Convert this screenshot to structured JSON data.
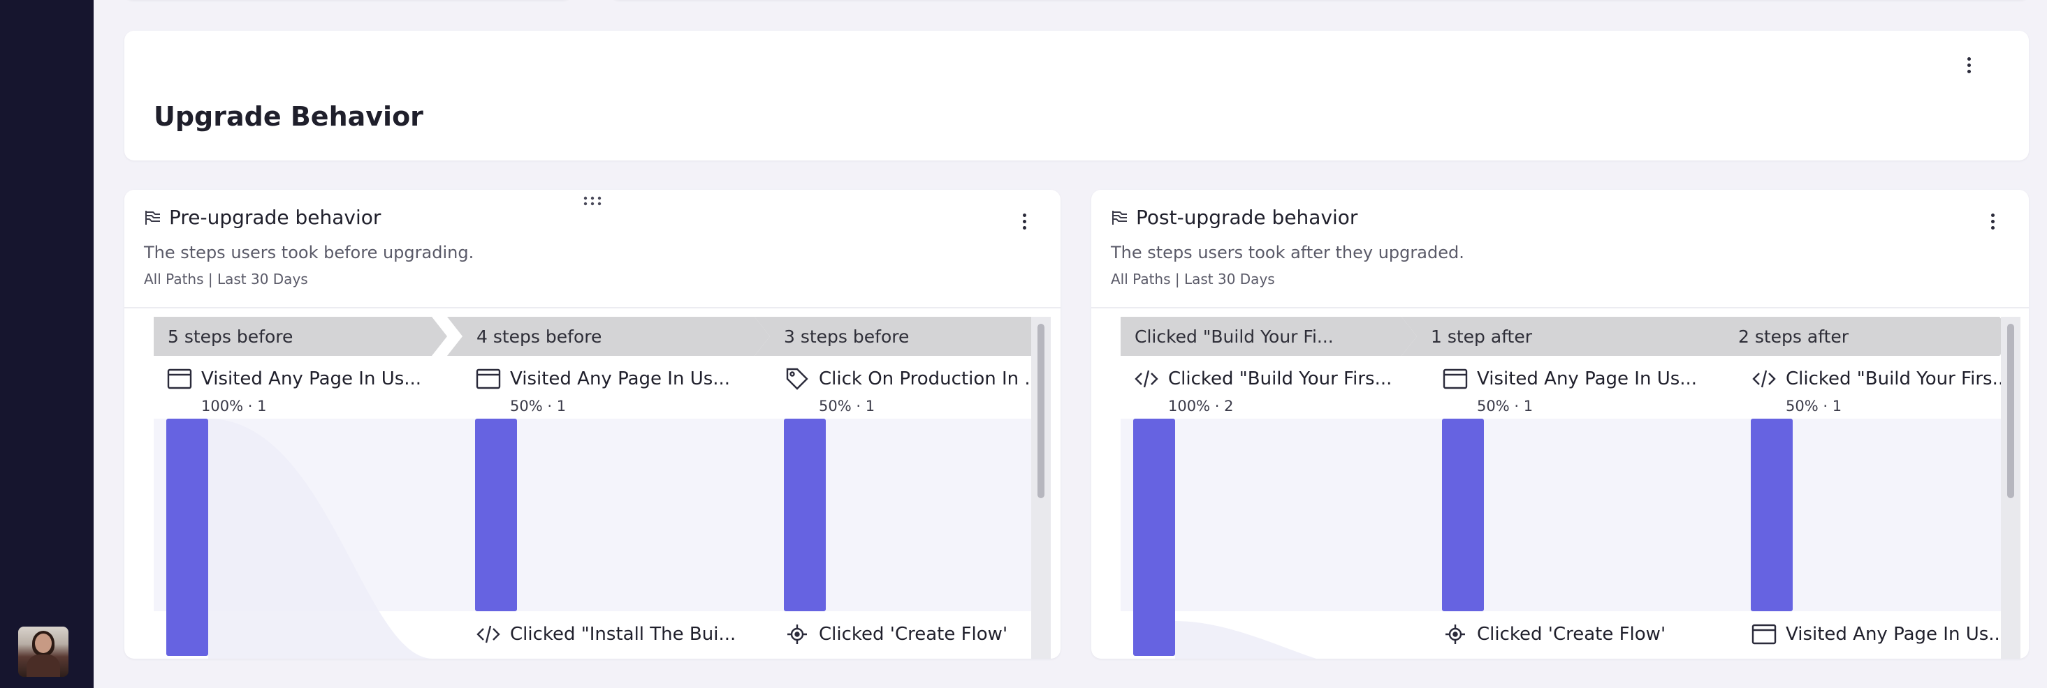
{
  "header": {
    "title": "Upgrade Behavior"
  },
  "panels": [
    {
      "title": "Pre-upgrade behavior",
      "description": "The steps users took before upgrading.",
      "meta": "All Paths | Last 30 Days",
      "steps": [
        {
          "label": "5 steps before",
          "node": "Visited Any Page In Us...",
          "stats": "100% · 1",
          "share": 1.0,
          "icon": "browser-window-icon",
          "bottom_node": ""
        },
        {
          "label": "4 steps before",
          "node": "Visited Any Page In Us...",
          "stats": "50% · 1",
          "share": 0.5,
          "icon": "browser-window-icon",
          "bottom_node": "Clicked \"Install The Bui...",
          "bottom_icon": "code-icon"
        },
        {
          "label": "3 steps before",
          "node": "Click On Production In ...",
          "stats": "50% · 1",
          "share": 0.5,
          "icon": "tag-icon",
          "bottom_node": "Clicked 'Create Flow'",
          "bottom_icon": "target-icon"
        }
      ]
    },
    {
      "title": "Post-upgrade behavior",
      "description": "The steps users took after they upgraded.",
      "meta": "All Paths | Last 30 Days",
      "steps": [
        {
          "label": "Clicked \"Build Your Fi...",
          "node": "Clicked \"Build Your Firs...",
          "stats": "100% · 2",
          "share": 1.0,
          "icon": "code-icon",
          "bottom_node": ""
        },
        {
          "label": "1 step after",
          "node": "Visited Any Page In Us...",
          "stats": "50% · 1",
          "share": 0.5,
          "icon": "browser-window-icon",
          "bottom_node": "Clicked 'Create Flow'",
          "bottom_icon": "target-icon"
        },
        {
          "label": "2 steps after",
          "node": "Clicked \"Build Your Firs...",
          "stats": "50% · 1",
          "share": 0.5,
          "icon": "code-icon",
          "bottom_node": "Visited Any Page In Us...",
          "bottom_icon": "browser-window-icon"
        }
      ]
    }
  ],
  "colors": {
    "bar": "#6663e1",
    "sidebar": "#16152e",
    "step_header": "#d4d4d6"
  }
}
